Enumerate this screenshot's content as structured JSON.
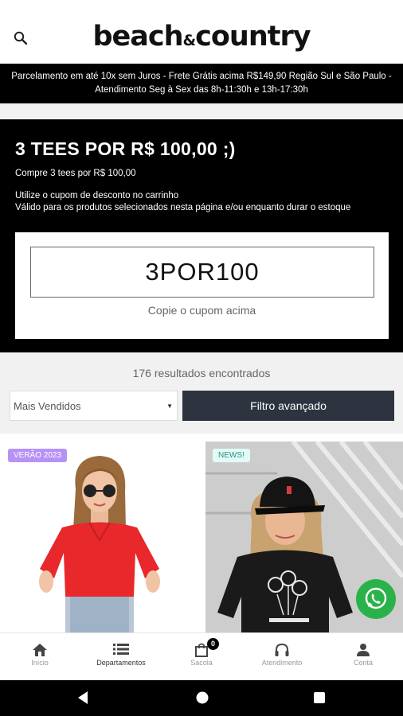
{
  "header": {
    "logo_main": "beach",
    "logo_amp": "&",
    "logo_end": "country",
    "search_icon": "search-icon"
  },
  "announcement": {
    "line1": "Parcelamento em até 10x sem Juros - Frete Grátis acima R$149,90 Região Sul e São Paulo -",
    "line2": "Atendimento Seg à Sex das 8h-11:30h e 13h-17:30h"
  },
  "promo": {
    "title": "3 TEES POR R$ 100,00 ;)",
    "subtitle": "Compre 3 tees por R$ 100,00",
    "line1": "Utilize o cupom de desconto no carrinho",
    "line2": "Válido para os produtos selecionados nesta página e/ou enquanto durar o estoque",
    "coupon_code": "3POR100",
    "coupon_hint": "Copie o cupom acima"
  },
  "listing": {
    "results_text": "176 resultados encontrados",
    "sort_selected": "Mais Vendidos",
    "filter_button": "Filtro avançado"
  },
  "products": [
    {
      "badge": "VERÃO 2023",
      "shirt_color": "#e8282b"
    },
    {
      "badge": "NEWS!",
      "shirt_color": "#1a1a1a"
    }
  ],
  "bottom_nav": {
    "items": [
      {
        "label": "Início",
        "icon": "home-icon"
      },
      {
        "label": "Departamentos",
        "icon": "list-icon"
      },
      {
        "label": "Sacola",
        "icon": "shopping-bag-icon"
      },
      {
        "label": "Atendimento",
        "icon": "headphones-icon"
      },
      {
        "label": "Conta",
        "icon": "user-icon"
      }
    ],
    "active_index": 1,
    "cart_count": "0"
  },
  "colors": {
    "filter_button": "#2d3440",
    "whatsapp": "#2ab24a",
    "badge_summer": "#b692f6",
    "badge_news": "#e2fbf6"
  }
}
